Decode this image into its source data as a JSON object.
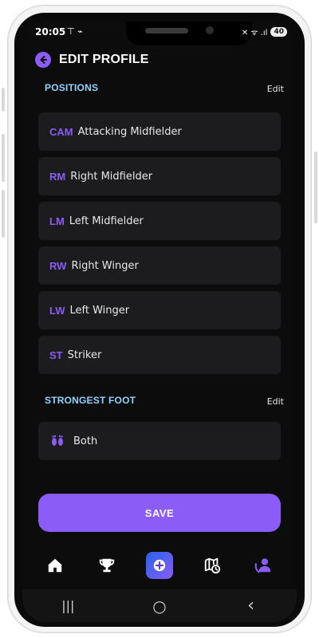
{
  "status_bar": {
    "time": "20:05",
    "left_icons": "⊤ ⌁",
    "right_icons": "✕ ᯤ .ıl",
    "battery": "40"
  },
  "header": {
    "title": "EDIT PROFILE"
  },
  "positions": {
    "title": "POSITIONS",
    "edit_label": "Edit",
    "items": [
      {
        "code": "CAM",
        "name": "Attacking Midfielder"
      },
      {
        "code": "RM",
        "name": "Right Midfielder"
      },
      {
        "code": "LM",
        "name": "Left Midfielder"
      },
      {
        "code": "RW",
        "name": "Right Winger"
      },
      {
        "code": "LW",
        "name": "Left Winger"
      },
      {
        "code": "ST",
        "name": "Striker"
      }
    ]
  },
  "strongest_foot": {
    "title": "STRONGEST FOOT",
    "edit_label": "Edit",
    "value": "Both",
    "icon": "feet-icon"
  },
  "save_label": "SAVE",
  "tabs": [
    "home-icon",
    "trophy-icon",
    "add-icon",
    "map-clock-icon",
    "profile-icon"
  ],
  "nav": {
    "recents": "|||",
    "home": "○",
    "back": "‹"
  },
  "colors": {
    "accent": "#8b5cf6",
    "section_title": "#8fd3ff",
    "card": "#1c1c1e"
  }
}
